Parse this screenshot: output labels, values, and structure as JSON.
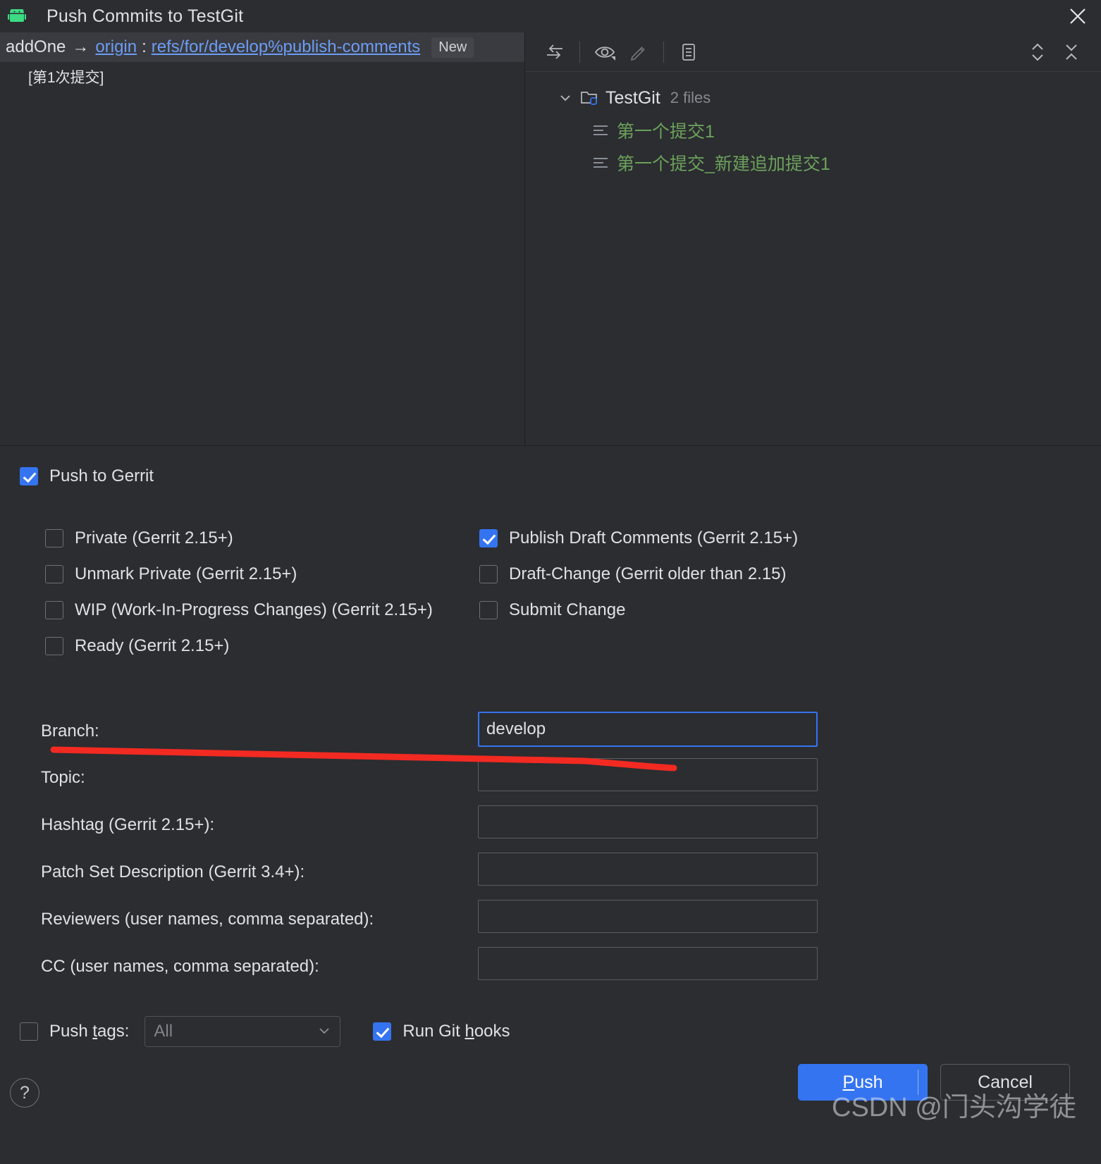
{
  "window": {
    "title": "Push Commits to TestGit",
    "app_icon": "android-robot-icon",
    "close_icon": "close-icon"
  },
  "commit_header": {
    "source_branch": "addOne",
    "arrow": "→",
    "remote": "origin",
    "separator": ":",
    "target_ref": "refs/for/develop%publish-comments",
    "badge": "New",
    "commit_message": "[第1次提交]"
  },
  "tree_toolbar": {
    "icons": [
      {
        "name": "show-diff-icon",
        "glyph": "swap-arrows"
      },
      {
        "name": "preview-eye-icon",
        "glyph": "eye"
      },
      {
        "name": "edit-pencil-icon",
        "glyph": "pencil"
      },
      {
        "name": "group-by-directory-icon",
        "glyph": "list"
      },
      {
        "name": "expand-all-icon",
        "glyph": "expand"
      },
      {
        "name": "collapse-all-icon",
        "glyph": "collapse"
      }
    ]
  },
  "tree": {
    "root": {
      "label": "TestGit",
      "count": "2 files",
      "caret": "chevron-down-icon",
      "icon": "module-folder-icon"
    },
    "children": [
      {
        "label": "第一个提交1",
        "icon": "file-text-icon"
      },
      {
        "label": "第一个提交_新建追加提交1",
        "icon": "file-text-icon"
      }
    ]
  },
  "options": {
    "push_to_gerrit": {
      "label": "Push to Gerrit",
      "checked": true
    },
    "left_column": [
      {
        "label": "Private (Gerrit 2.15+)",
        "checked": false
      },
      {
        "label": "Unmark Private (Gerrit 2.15+)",
        "checked": false
      },
      {
        "label": "WIP (Work-In-Progress Changes) (Gerrit 2.15+)",
        "checked": false
      },
      {
        "label": "Ready (Gerrit 2.15+)",
        "checked": false
      }
    ],
    "right_column": [
      {
        "label": "Publish Draft Comments (Gerrit 2.15+)",
        "checked": true
      },
      {
        "label": "Draft-Change (Gerrit older than 2.15)",
        "checked": false
      },
      {
        "label": "Submit Change",
        "checked": false
      }
    ]
  },
  "fields": [
    {
      "label": "Branch:",
      "value": "develop",
      "placeholder": "",
      "focused": true
    },
    {
      "label": "Topic:",
      "value": "",
      "placeholder": "",
      "focused": false
    },
    {
      "label": "Hashtag (Gerrit 2.15+):",
      "value": "",
      "placeholder": "",
      "focused": false
    },
    {
      "label": "Patch Set Description (Gerrit 3.4+):",
      "value": "",
      "placeholder": "",
      "focused": false
    },
    {
      "label": "Reviewers (user names, comma separated):",
      "value": "",
      "placeholder": "",
      "focused": false
    },
    {
      "label": "CC (user names, comma separated):",
      "value": "",
      "placeholder": "",
      "focused": false
    }
  ],
  "bottom": {
    "push_tags": {
      "label_pre": "Push ",
      "label_accel": "t",
      "label_post": "ags:",
      "checked": false
    },
    "tags_combo": {
      "value": "All",
      "arrow": "chevron-down-icon"
    },
    "run_git_hooks": {
      "label_pre": "Run Git ",
      "label_accel": "h",
      "label_post": "ooks",
      "checked": true
    },
    "help_label": "?",
    "push_button": {
      "accel": "P",
      "rest": "ush"
    },
    "cancel_button": "Cancel"
  },
  "watermark": "CSDN @门头沟学徒",
  "colors": {
    "accent": "#3574f0",
    "link": "#6d9cf5",
    "file_green": "#6ca15c",
    "background": "#2b2d30",
    "header_bg": "#393b40",
    "annotation_red": "#f22a22"
  }
}
